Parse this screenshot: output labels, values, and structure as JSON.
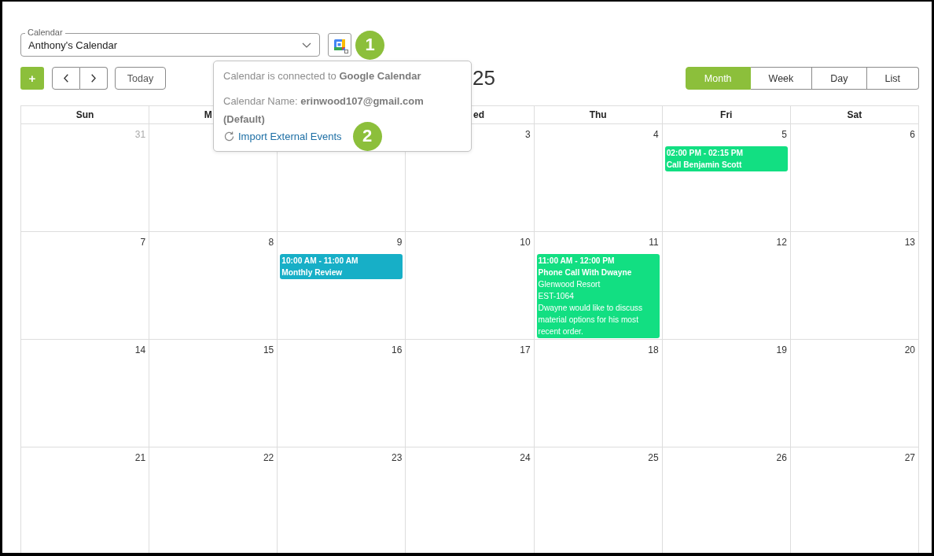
{
  "header": {
    "calendar_select": {
      "label": "Calendar",
      "value": "Anthony's Calendar"
    },
    "step_badge": "1"
  },
  "toolbar": {
    "add_button": "+",
    "today_button": "Today",
    "title": "25",
    "views": [
      {
        "label": "Month",
        "selected": true
      },
      {
        "label": "Week",
        "selected": false
      },
      {
        "label": "Day",
        "selected": false
      },
      {
        "label": "List",
        "selected": false
      }
    ]
  },
  "popover": {
    "status": "Calendar is connected to **Google Calendar**",
    "calendar_name": "Calendar Name: **erinwood107@gmail.com (Default)**",
    "import_link": "Import External Events",
    "step_badge": "2"
  },
  "weekdays": [
    {
      "kind": "whole",
      "label": "Sun"
    },
    {
      "kind": "head",
      "label": "M"
    },
    {
      "kind": "blank"
    },
    {
      "kind": "tail",
      "label": "ed"
    },
    {
      "kind": "whole",
      "label": "Thu"
    },
    {
      "kind": "whole",
      "label": "Fri"
    },
    {
      "kind": "whole",
      "label": "Sat"
    }
  ],
  "weeks": [
    {
      "days": [
        {
          "kind": "date",
          "number": "31",
          "outside": true
        },
        {
          "kind": "blank"
        },
        {
          "kind": "blank"
        },
        {
          "kind": "date",
          "number": "3",
          "outside": false
        },
        {
          "kind": "date",
          "number": "4",
          "outside": false
        },
        {
          "kind": "date",
          "number": "5",
          "outside": false,
          "events": [
            {
              "time": "02:00 PM - 02:15 PM",
              "title": "Call Benjamin Scott",
              "color": "#12df82"
            }
          ]
        },
        {
          "kind": "date",
          "number": "6",
          "outside": false
        }
      ]
    },
    {
      "days": [
        {
          "kind": "date",
          "number": "7",
          "outside": false
        },
        {
          "kind": "date",
          "number": "8",
          "outside": false
        },
        {
          "kind": "date",
          "number": "9",
          "outside": false,
          "events": [
            {
              "time": "10:00 AM - 11:00 AM",
              "title": "Monthly Review",
              "color": "#17afc7"
            }
          ]
        },
        {
          "kind": "date",
          "number": "10",
          "outside": false
        },
        {
          "kind": "date",
          "number": "11",
          "outside": false,
          "events": [
            {
              "time": "11:00 AM - 12:00 PM",
              "title": "Phone Call With Dwayne",
              "color": "#12df82",
              "details": [
                "Glenwood Resort",
                "EST-1064",
                "Dwayne would like to discuss material options for his most recent order."
              ]
            }
          ]
        },
        {
          "kind": "date",
          "number": "12",
          "outside": false
        },
        {
          "kind": "date",
          "number": "13",
          "outside": false
        }
      ]
    },
    {
      "days": [
        {
          "kind": "date",
          "number": "14",
          "outside": false
        },
        {
          "kind": "date",
          "number": "15",
          "outside": false
        },
        {
          "kind": "date",
          "number": "16",
          "outside": false
        },
        {
          "kind": "date",
          "number": "17",
          "outside": false
        },
        {
          "kind": "date",
          "number": "18",
          "outside": false
        },
        {
          "kind": "date",
          "number": "19",
          "outside": false
        },
        {
          "kind": "date",
          "number": "20",
          "outside": false
        }
      ]
    },
    {
      "days": [
        {
          "kind": "date",
          "number": "21",
          "outside": false
        },
        {
          "kind": "date",
          "number": "22",
          "outside": false
        },
        {
          "kind": "date",
          "number": "23",
          "outside": false
        },
        {
          "kind": "date",
          "number": "24",
          "outside": false
        },
        {
          "kind": "date",
          "number": "25",
          "outside": false
        },
        {
          "kind": "date",
          "number": "26",
          "outside": false
        },
        {
          "kind": "date",
          "number": "27",
          "outside": false
        }
      ]
    }
  ]
}
